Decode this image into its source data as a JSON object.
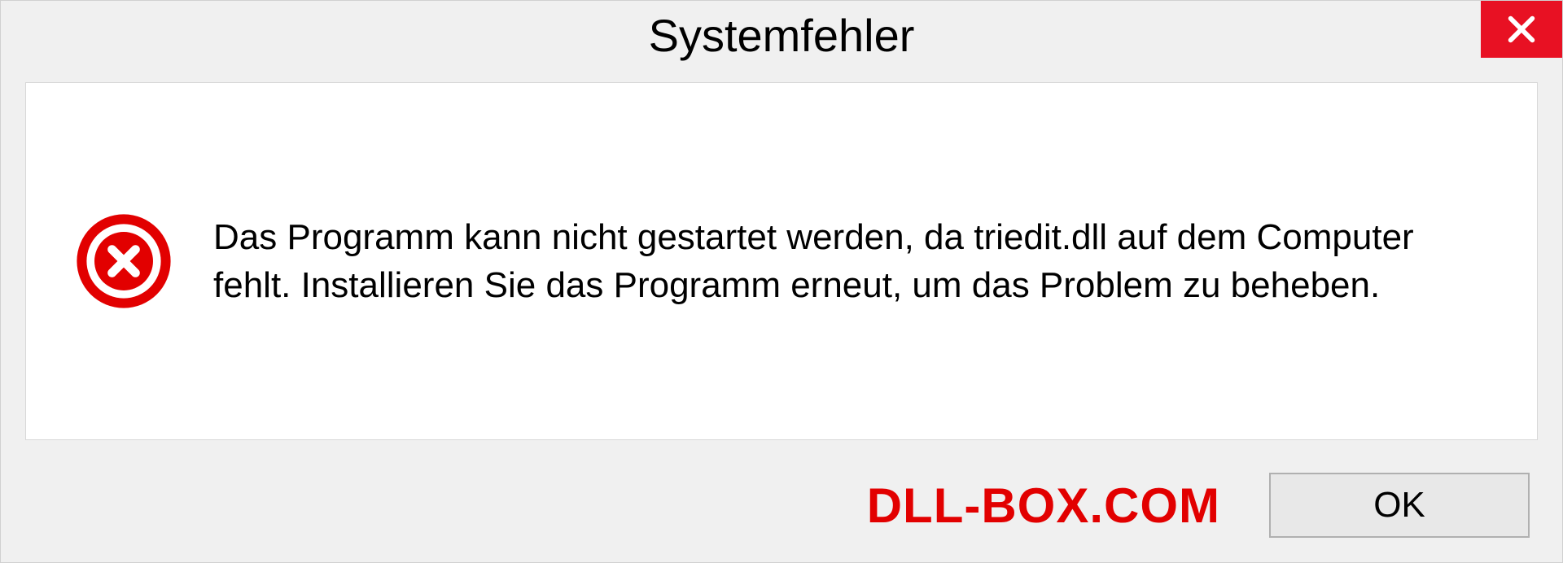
{
  "dialog": {
    "title": "Systemfehler",
    "message": "Das Programm kann nicht gestartet werden, da triedit.dll auf dem Computer fehlt. Installieren Sie das Programm erneut, um das Problem zu beheben.",
    "ok_label": "OK"
  },
  "watermark": "DLL-BOX.COM",
  "colors": {
    "close_button": "#e81123",
    "error_icon": "#e20000",
    "watermark": "#e20000"
  }
}
